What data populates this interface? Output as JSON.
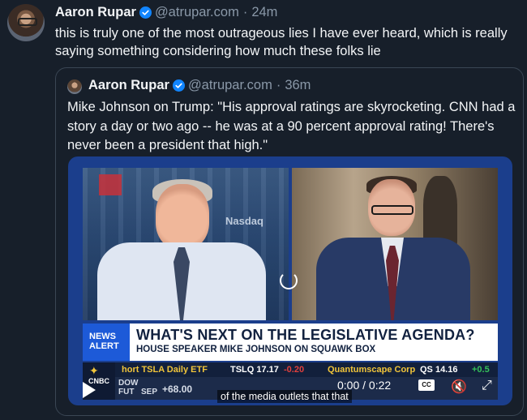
{
  "post": {
    "author_name": "Aaron Rupar",
    "handle": "@atrupar.com",
    "separator": "·",
    "time": "24m",
    "text": "this is truly one of the most outrageous lies I have ever heard, which is really saying something considering how much these folks lie"
  },
  "quoted": {
    "author_name": "Aaron Rupar",
    "handle": "@atrupar.com",
    "separator": "·",
    "time": "36m",
    "text": "Mike Johnson on Trump: \"His approval ratings are skyrocketing. CNN had a story a day or two ago -- he was at a 90 percent approval rating! There's never been a president that high.\""
  },
  "video": {
    "watermark": "Nasdaq",
    "news_alert": "NEWS ALERT",
    "headline": "WHAT'S NEXT ON THE LEGISLATIVE AGENDA?",
    "subhead": "HOUSE SPEAKER MIKE JOHNSON ON SQUAWK BOX",
    "ticker_1": "hort TSLA Daily ETF",
    "ticker_2": "TSLQ 17.17",
    "ticker_3": "-0.20",
    "ticker_4": "Quantumscape Corp",
    "ticker_5": "QS 14.16",
    "ticker_6": "+0.5",
    "cnbc_label": "CNBC",
    "dow_label": "DOW",
    "fut_label": "FUT",
    "sep_label": "SEP",
    "dow_change": "+68.00",
    "caption": "of the media outlets that that",
    "time_display": "0:00 / 0:22",
    "cc_label": "CC",
    "colors": {
      "channel_blue": "#1d5ad8",
      "ticker_red": "#e0403c",
      "ticker_green": "#35c25a"
    }
  }
}
